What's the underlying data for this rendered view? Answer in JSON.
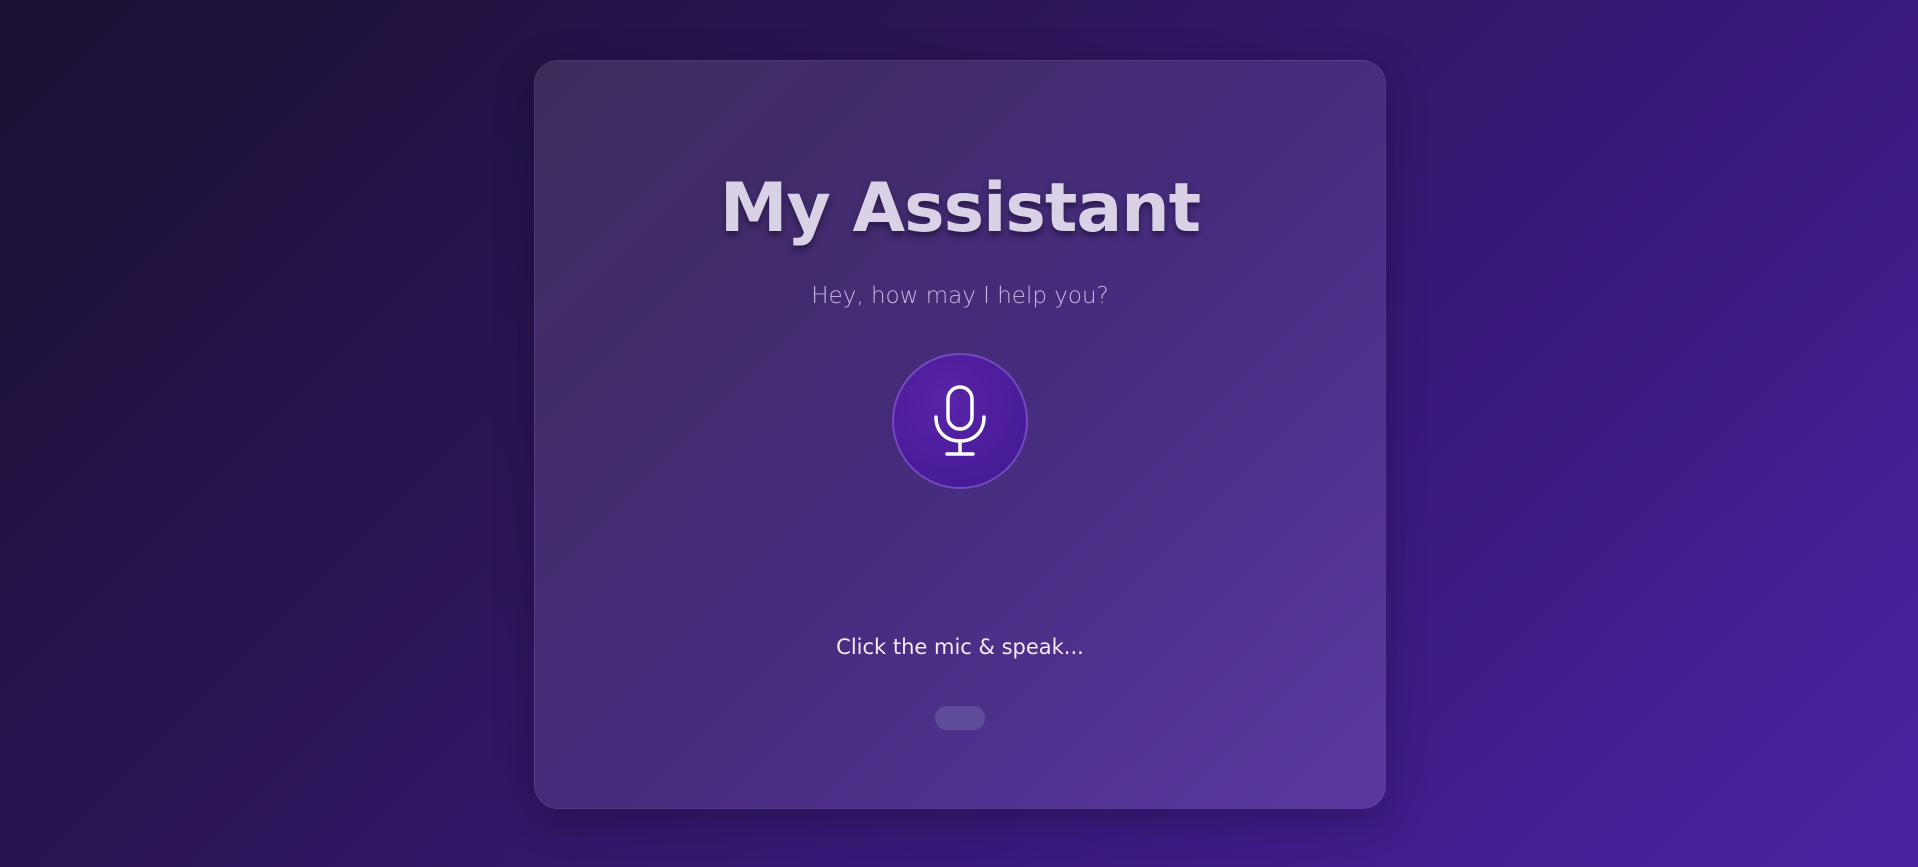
{
  "app": {
    "title": "My Assistant",
    "subtitle": "Hey, how may I help you?",
    "status_text": "Click the mic & speak..."
  },
  "mic": {
    "icon": "microphone-icon",
    "label": ""
  },
  "colors": {
    "accent": "#4a1c9a",
    "background_start": "#1a1030",
    "background_end": "#4a23a3"
  }
}
